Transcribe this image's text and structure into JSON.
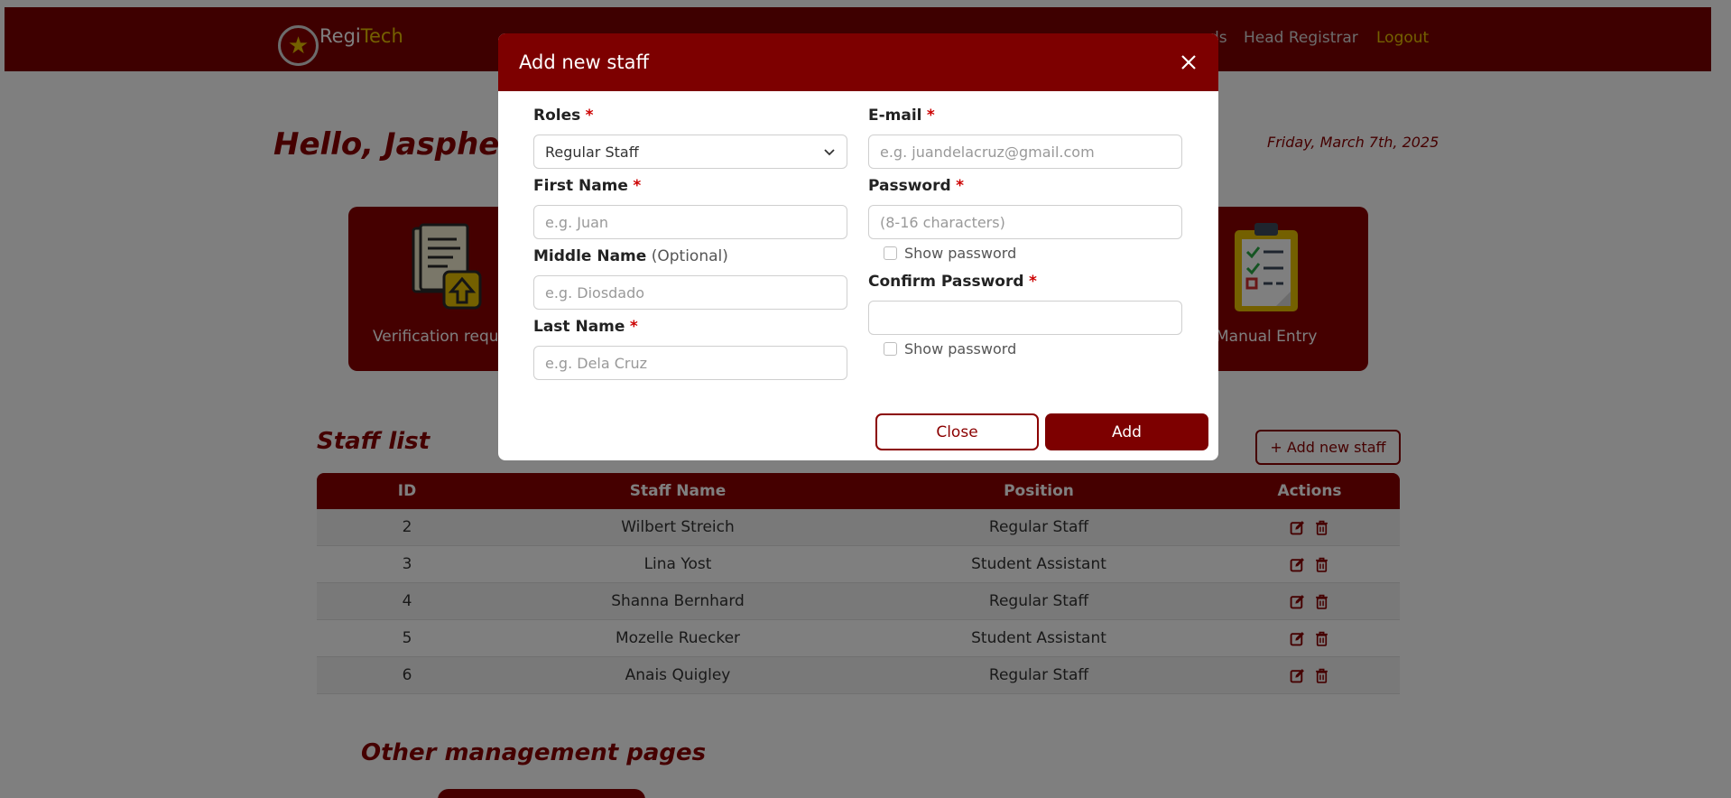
{
  "header": {
    "brand_prefix": "Regi",
    "brand_accent": "Tech",
    "nav_partial": "ds",
    "nav_head_registrar": "Head Registrar",
    "nav_logout": "Logout"
  },
  "main": {
    "greeting": "Hello, Jaspher X",
    "date": "Friday, March 7th, 2025",
    "cards": [
      {
        "label": "Verification requ",
        "icon": "document-upload-icon"
      },
      {
        "label": "Manual Entry",
        "icon": "clipboard-checklist-icon"
      }
    ]
  },
  "staff": {
    "title": "Staff list",
    "add_button": "+ Add new staff",
    "columns": [
      "ID",
      "Staff Name",
      "Position",
      "Actions"
    ],
    "rows": [
      {
        "id": "2",
        "name": "Wilbert Streich",
        "position": "Regular Staff"
      },
      {
        "id": "3",
        "name": "Lina Yost",
        "position": "Student Assistant"
      },
      {
        "id": "4",
        "name": "Shanna Bernhard",
        "position": "Regular Staff"
      },
      {
        "id": "5",
        "name": "Mozelle Ruecker",
        "position": "Student Assistant"
      },
      {
        "id": "6",
        "name": "Anais Quigley",
        "position": "Regular Staff"
      }
    ]
  },
  "other": {
    "title": "Other management pages"
  },
  "modal": {
    "title": "Add new staff",
    "roles_label": "Roles",
    "roles_value": "Regular Staff",
    "first_name_label": "First Name",
    "first_name_placeholder": "e.g. Juan",
    "middle_name_label": "Middle Name",
    "middle_name_optional": "(Optional)",
    "middle_name_placeholder": "e.g. Diosdado",
    "last_name_label": "Last Name",
    "last_name_placeholder": "e.g. Dela Cruz",
    "email_label": "E-mail",
    "email_placeholder": "e.g. juandelacruz@gmail.com",
    "password_label": "Password",
    "password_placeholder": "(8-16 characters)",
    "show_password": "Show password",
    "confirm_password_label": "Confirm Password",
    "required_mark": "*",
    "close_button": "Close",
    "add_button": "Add"
  },
  "colors": {
    "primary": "#7d0000",
    "accent": "#e8c100",
    "required": "#cc0000"
  }
}
